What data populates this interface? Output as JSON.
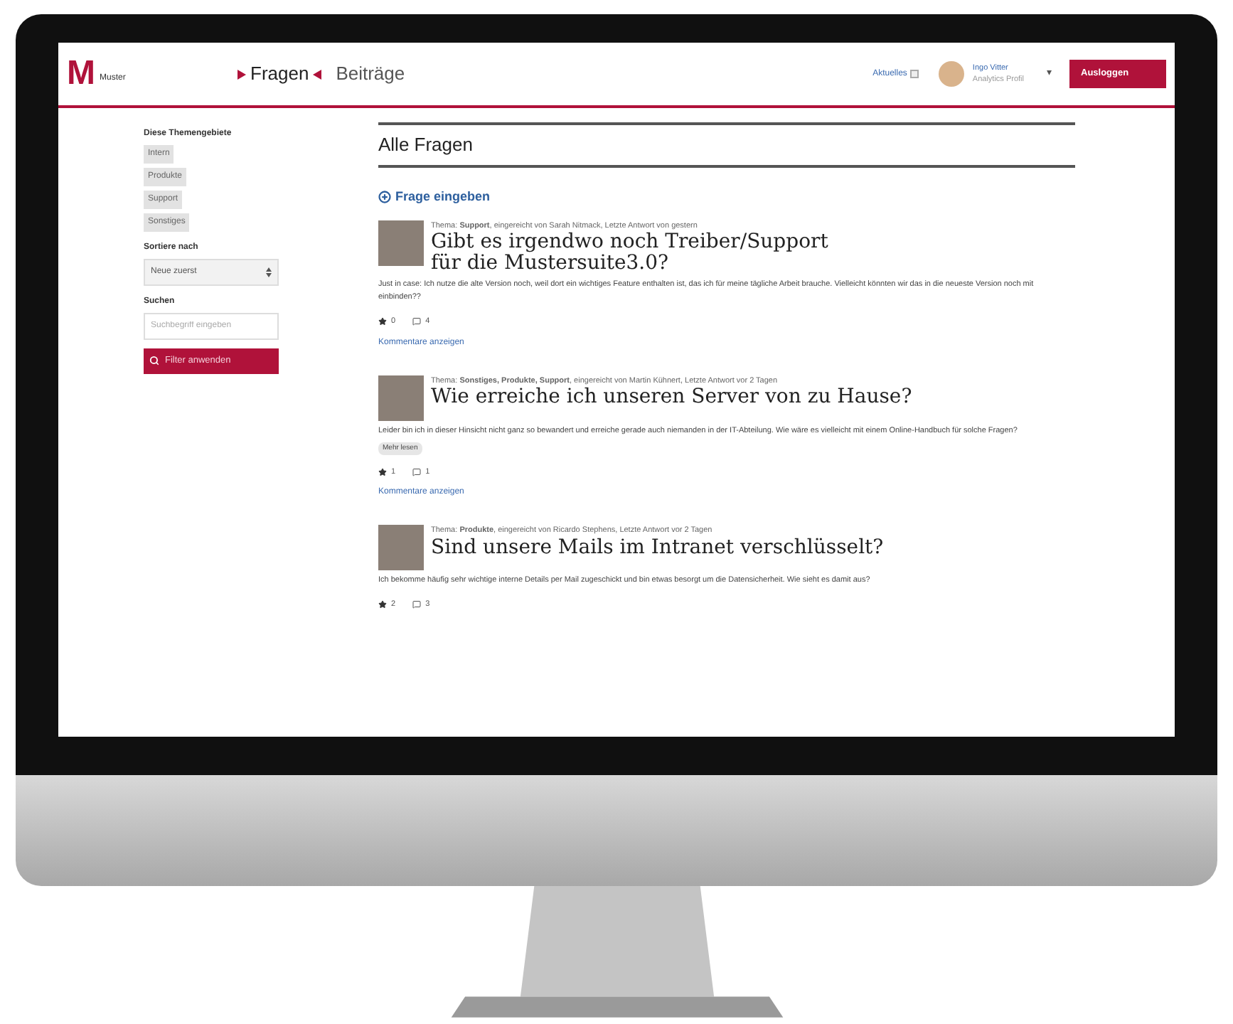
{
  "header": {
    "logo": {
      "letter": "M",
      "name": "Muster"
    },
    "nav": [
      {
        "label": "Fragen",
        "selected": true
      },
      {
        "label": "Beiträge",
        "selected": false
      }
    ],
    "news": "Aktuelles",
    "user": {
      "name": "Ingo Vitter",
      "role": "Analytics Profil",
      "caret": "▾"
    },
    "logout": "Ausloggen"
  },
  "sidebar": {
    "topics_label": "Diese Themengebiete",
    "topics": [
      "Intern",
      "Produkte",
      "Support",
      "Sonstiges"
    ],
    "sort_label": "Sortiere nach",
    "sort_value": "Neue zuerst",
    "search_label": "Suchen",
    "search_placeholder": "Suchbegriff eingeben",
    "filter_button": "Filter anwenden"
  },
  "main": {
    "heading": "Alle Fragen",
    "new_question": "Frage eingeben",
    "questions": [
      {
        "meta": "Thema: **Support**, eingereicht von Sarah Nitmack, Letzte Antwort von gestern",
        "title": "Gibt es irgendwo noch Treiber/Support für die Mustersuite3.0?",
        "body": "Just in case: Ich nutze die alte Version noch, weil dort ein wichtiges Feature enthalten ist, das ich für meine tägliche Arbeit brauche. Vielleicht könnten wir das in die neueste Version noch mit einbinden??",
        "likes": "0",
        "comments": "4",
        "link": "Kommentare anzeigen"
      },
      {
        "meta": "Thema: **Sonstiges, Produkte, Support**, eingereicht von Martin Kühnert, Letzte Antwort vor 2 Tagen",
        "title": "Wie erreiche ich unseren Server von zu Hause?",
        "body": "Leider bin ich in dieser Hinsicht nicht ganz so bewandert und erreiche gerade auch niemanden in der IT-Abteilung. Wie wäre es vielleicht mit einem Online-Handbuch für solche Fragen?",
        "tag": "Mehr lesen",
        "likes": "1",
        "comments": "1",
        "link": "Kommentare anzeigen"
      },
      {
        "meta": "Thema: **Produkte**, eingereicht von Ricardo Stephens, Letzte Antwort vor 2 Tagen",
        "title": "Sind unsere Mails im Intranet verschlüsselt?",
        "body": "Ich bekomme häufig sehr wichtige interne Details per Mail zugeschickt und bin etwas besorgt um die Datensicherheit. Wie sieht es damit aus?",
        "likes": "2",
        "comments": "3"
      }
    ]
  }
}
